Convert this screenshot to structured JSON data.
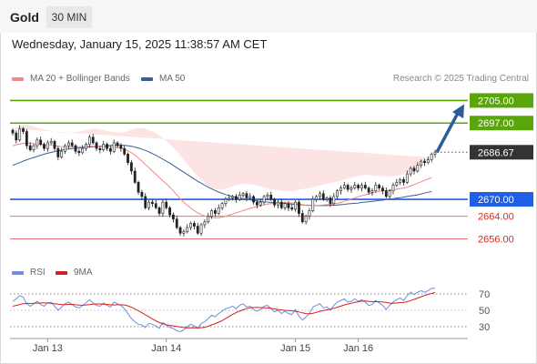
{
  "header": {
    "symbol": "Gold",
    "timeframe": "30 MIN"
  },
  "datetime": "Wednesday, January 15, 2025 11:38:57 AM CET",
  "legend": {
    "ma20": {
      "label": "MA 20 + Bollinger Bands",
      "color": "#f08a84"
    },
    "ma50": {
      "label": "MA 50",
      "color": "#3a5e94"
    },
    "rsi": {
      "label": "RSI",
      "color": "#6d8fd8"
    },
    "rsi9": {
      "label": "9MA",
      "color": "#d62020"
    }
  },
  "credit": "Research © 2025 Trading Central",
  "colors": {
    "green": "#5aa60a",
    "blue": "#1e5fe6",
    "red": "#e8736e",
    "current": "#333333",
    "bull": "#ffffff",
    "bear": "#222222",
    "band": "#fde4e4",
    "arrow": "#2e5c9a"
  },
  "chart_data": [
    {
      "type": "candlestick",
      "title": "Gold 30 MIN",
      "x_ticks": [
        "Jan 13",
        "Jan 14",
        "Jan 15",
        "Jan 16"
      ],
      "ylim": [
        2651,
        2709
      ],
      "current_price": "2686.67",
      "levels": [
        {
          "value": 2705.0,
          "label": "2705.00",
          "style": "green"
        },
        {
          "value": 2697.0,
          "label": "2697.00",
          "style": "green"
        },
        {
          "value": 2670.0,
          "label": "2670.00",
          "style": "blue"
        },
        {
          "value": 2664.0,
          "label": "2664.00",
          "style": "red"
        },
        {
          "value": 2656.0,
          "label": "2656.00",
          "style": "red"
        }
      ],
      "projection": {
        "from": 2686.67,
        "to": 2705.0
      },
      "close": [
        2693.5,
        2691,
        2695,
        2694,
        2689,
        2687.5,
        2689,
        2691,
        2689.5,
        2688,
        2690,
        2690.5,
        2688,
        2685,
        2687,
        2689,
        2690,
        2689,
        2687,
        2686.5,
        2688,
        2689.5,
        2692,
        2690,
        2688,
        2687.5,
        2689.5,
        2688,
        2687,
        2690,
        2689,
        2688,
        2686,
        2683,
        2680,
        2676,
        2672.5,
        2671,
        2667,
        2669,
        2668.5,
        2667,
        2665,
        2669,
        2667,
        2664.5,
        2663,
        2660,
        2658,
        2658.5,
        2660,
        2661.5,
        2660.5,
        2658,
        2661,
        2662,
        2664,
        2666,
        2665,
        2667,
        2668.5,
        2670,
        2670.5,
        2671,
        2670,
        2671.5,
        2672,
        2670.5,
        2671,
        2669,
        2668,
        2669,
        2671,
        2671.5,
        2670,
        2668,
        2669,
        2667,
        2668.5,
        2667,
        2666.5,
        2669,
        2665,
        2662,
        2664,
        2666,
        2670,
        2671,
        2672,
        2670,
        2670.5,
        2668.5,
        2671,
        2673,
        2674,
        2675,
        2673.5,
        2674,
        2675,
        2674,
        2675,
        2674,
        2672.5,
        2673,
        2675,
        2674,
        2673,
        2671,
        2673,
        2675,
        2676,
        2677,
        2676,
        2679,
        2681,
        2680,
        2682,
        2683.5,
        2683,
        2684,
        2686,
        2686.7
      ],
      "ma20": [
        2689,
        2689.3,
        2689.6,
        2689.8,
        2690,
        2689.9,
        2689.7,
        2689.5,
        2689.4,
        2689.3,
        2689.3,
        2689.2,
        2689,
        2688.8,
        2688.6,
        2688.5,
        2688.5,
        2688.6,
        2688.6,
        2688.6,
        2688.6,
        2688.7,
        2688.8,
        2688.8,
        2688.8,
        2688.7,
        2688.7,
        2688.7,
        2688.6,
        2688.5,
        2688.4,
        2688.2,
        2687.8,
        2687.2,
        2686.5,
        2685.7,
        2684.6,
        2683.5,
        2682.3,
        2681.2,
        2680,
        2678.9,
        2677.7,
        2676.6,
        2675.5,
        2674.3,
        2673,
        2671.6,
        2670.2,
        2669,
        2667.9,
        2666.9,
        2666,
        2665.2,
        2664.6,
        2664.1,
        2663.8,
        2663.6,
        2663.5,
        2663.5,
        2663.7,
        2664,
        2664.4,
        2664.8,
        2665.2,
        2665.6,
        2666,
        2666.4,
        2666.8,
        2667.1,
        2667.4,
        2667.7,
        2668,
        2668.3,
        2668.5,
        2668.6,
        2668.7,
        2668.8,
        2668.8,
        2668.8,
        2668.7,
        2668.6,
        2668.4,
        2668.1,
        2667.9,
        2667.8,
        2667.8,
        2667.8,
        2667.9,
        2668,
        2668.1,
        2668.2,
        2668.4,
        2668.6,
        2668.9,
        2669.3,
        2669.7,
        2670.1,
        2670.5,
        2670.9,
        2671.3,
        2671.6,
        2671.9,
        2672.2,
        2672.5,
        2672.8,
        2673,
        2673.1,
        2673.2,
        2673.4,
        2673.6,
        2673.8,
        2674,
        2674.3,
        2674.7,
        2675.2,
        2675.7,
        2676.2,
        2676.7,
        2677.2,
        2677.6
      ],
      "bb_upper": [
        2695,
        2695.5,
        2696,
        2696.3,
        2696.5,
        2696.2,
        2695.8,
        2695.4,
        2695,
        2694.7,
        2694.5,
        2694.3,
        2694,
        2693.8,
        2693.6,
        2693.5,
        2693.5,
        2693.6,
        2693.8,
        2694,
        2694.2,
        2694.5,
        2694.8,
        2695,
        2695,
        2694.8,
        2694.5,
        2694.2,
        2694,
        2693.8,
        2693.6,
        2693.6,
        2693.8,
        2694.2,
        2694.6,
        2695,
        2695.2,
        2695.2,
        2695,
        2694.6,
        2694.1,
        2693.4,
        2692.6,
        2691.7,
        2690.7,
        2689.6,
        2688.4,
        2687,
        2685.5,
        2684,
        2682.5,
        2681,
        2679.6,
        2678.3,
        2677,
        2675.8,
        2674.8,
        2674,
        2673.6,
        2673.4,
        2673.5,
        2673.8,
        2674.2,
        2674.6,
        2675,
        2675.3,
        2675.5,
        2675.5,
        2675.4,
        2675.2,
        2674.9,
        2674.5,
        2674.2,
        2673.9,
        2673.6,
        2673.4,
        2673.2,
        2673,
        2672.9,
        2672.8,
        2672.8,
        2673,
        2673.3,
        2673.6,
        2673.8,
        2674,
        2674.3,
        2674.6,
        2674.9,
        2675.2,
        2675.5,
        2675.8,
        2676,
        2676.3,
        2676.6,
        2677,
        2677.4,
        2677.7,
        2678,
        2678.3,
        2678.5,
        2678.6,
        2678.6,
        2678.5,
        2678.4,
        2678.3,
        2678.2,
        2678.1,
        2678,
        2678.1,
        2678.3,
        2678.6,
        2679,
        2679.5,
        2680.1,
        2680.8,
        2681.6,
        2682.4,
        2683.2,
        2684,
        2684.8
      ],
      "bb_lower": [
        2683,
        2683.1,
        2683.2,
        2683.3,
        2683.5,
        2683.6,
        2683.6,
        2683.6,
        2683.8,
        2683.9,
        2684.1,
        2684.1,
        2684,
        2683.8,
        2683.6,
        2683.5,
        2683.5,
        2683.6,
        2683.4,
        2683.2,
        2683,
        2682.9,
        2682.8,
        2682.6,
        2682.6,
        2682.6,
        2682.9,
        2683.2,
        2683.2,
        2683.2,
        2683.2,
        2682.8,
        2681.8,
        2680.2,
        2678.4,
        2676.4,
        2674,
        2671.8,
        2669.6,
        2667.8,
        2665.9,
        2664.4,
        2662.8,
        2661.5,
        2660.3,
        2659,
        2657.6,
        2656.2,
        2654.9,
        2654,
        2653.3,
        2652.8,
        2652.4,
        2652.1,
        2652.2,
        2652.4,
        2652.8,
        2653.2,
        2653.4,
        2653.6,
        2653.9,
        2654.2,
        2654.6,
        2655,
        2655.4,
        2655.9,
        2656.5,
        2657.3,
        2658.2,
        2659,
        2659.9,
        2660.9,
        2661.8,
        2662.7,
        2663.4,
        2663.8,
        2664.2,
        2664.6,
        2664.7,
        2664.8,
        2664.6,
        2664.2,
        2663.5,
        2662.6,
        2662,
        2661.6,
        2661.3,
        2661,
        2660.9,
        2660.8,
        2660.7,
        2660.6,
        2660.8,
        2660.9,
        2661.2,
        2661.6,
        2662,
        2662.5,
        2663,
        2663.5,
        2664.1,
        2664.6,
        2665.2,
        2665.9,
        2666.6,
        2667.3,
        2667.8,
        2668.1,
        2668.4,
        2668.7,
        2668.9,
        2669,
        2669,
        2669.1,
        2669.3,
        2669.6,
        2669.8,
        2670,
        2670.2,
        2670.4,
        2670.4
      ],
      "ma50": [
        2682,
        2682.5,
        2683,
        2683.5,
        2684,
        2684.4,
        2684.8,
        2685.2,
        2685.6,
        2686,
        2686.3,
        2686.6,
        2686.9,
        2687.2,
        2687.4,
        2687.6,
        2687.8,
        2688,
        2688.1,
        2688.2,
        2688.3,
        2688.4,
        2688.5,
        2688.6,
        2688.7,
        2688.8,
        2688.9,
        2689,
        2689.1,
        2689.2,
        2689.2,
        2689.2,
        2689.1,
        2689,
        2688.8,
        2688.5,
        2688.2,
        2687.8,
        2687.3,
        2686.8,
        2686.2,
        2685.6,
        2684.9,
        2684.2,
        2683.5,
        2682.8,
        2682,
        2681.2,
        2680.4,
        2679.6,
        2678.8,
        2678,
        2677.2,
        2676.4,
        2675.7,
        2675,
        2674.3,
        2673.7,
        2673.1,
        2672.6,
        2672.1,
        2671.7,
        2671.3,
        2671,
        2670.7,
        2670.4,
        2670.2,
        2670,
        2669.8,
        2669.6,
        2669.4,
        2669.2,
        2669.1,
        2669,
        2668.9,
        2668.8,
        2668.7,
        2668.6,
        2668.5,
        2668.4,
        2668.3,
        2668.2,
        2668.1,
        2668,
        2667.9,
        2667.9,
        2667.8,
        2667.8,
        2667.8,
        2667.8,
        2667.8,
        2667.9,
        2667.9,
        2668,
        2668.1,
        2668.2,
        2668.4,
        2668.5,
        2668.6,
        2668.7,
        2668.9,
        2669,
        2669.1,
        2669.3,
        2669.4,
        2669.6,
        2669.7,
        2669.9,
        2670,
        2670.2,
        2670.4,
        2670.6,
        2670.8,
        2671,
        2671.2,
        2671.4,
        2671.6,
        2671.9,
        2672.2,
        2672.5,
        2672.8
      ],
      "x_tick_index": [
        10,
        44,
        81,
        99
      ],
      "price_axis": "right"
    },
    {
      "type": "line",
      "title": "RSI",
      "ylim": [
        20,
        80
      ],
      "y_ticks": [
        "70",
        "50",
        "30"
      ],
      "series": [
        {
          "name": "RSI",
          "values": [
            61,
            64,
            68,
            66,
            58,
            55,
            58,
            61,
            57,
            55,
            59,
            60,
            55,
            50,
            54,
            58,
            60,
            57,
            54,
            53,
            56,
            59,
            63,
            59,
            56,
            55,
            59,
            56,
            54,
            60,
            58,
            56,
            52,
            46,
            40,
            36,
            33,
            32,
            29,
            34,
            33,
            31,
            28,
            35,
            32,
            29,
            28,
            25,
            24,
            26,
            30,
            33,
            31,
            28,
            34,
            36,
            40,
            44,
            42,
            46,
            49,
            52,
            53,
            55,
            52,
            56,
            58,
            54,
            55,
            51,
            49,
            51,
            55,
            56,
            52,
            48,
            50,
            46,
            49,
            46,
            45,
            51,
            43,
            38,
            42,
            46,
            54,
            56,
            58,
            53,
            54,
            50,
            56,
            60,
            62,
            64,
            60,
            61,
            64,
            61,
            63,
            60,
            56,
            57,
            62,
            59,
            56,
            51,
            56,
            60,
            63,
            65,
            62,
            68,
            72,
            69,
            72,
            74,
            72,
            74,
            77,
            77
          ]
        },
        {
          "name": "9MA",
          "values": [
            55,
            56,
            57,
            58,
            58.5,
            58.5,
            58.6,
            58.8,
            59,
            59,
            59,
            58.5,
            58,
            57.5,
            57,
            57,
            57.2,
            57.2,
            56.8,
            56.4,
            56.2,
            56.5,
            57,
            57.5,
            57.8,
            57.8,
            57.6,
            57.2,
            56.8,
            56.6,
            56.8,
            56.8,
            56.5,
            55.5,
            53.8,
            51.8,
            49.5,
            47,
            44.5,
            42,
            39.5,
            37.2,
            35,
            33.4,
            32.3,
            31.5,
            31,
            30.3,
            29.6,
            29,
            28.7,
            28.6,
            28.8,
            28.6,
            28.8,
            29.3,
            30.5,
            32.2,
            33.8,
            35.6,
            37.5,
            39.9,
            42.5,
            45,
            47.2,
            49,
            50.6,
            52,
            53.1,
            53.5,
            53.6,
            53.3,
            53,
            52.9,
            52.5,
            51.7,
            51,
            50.5,
            50,
            49.7,
            49.3,
            49,
            48,
            46.9,
            46,
            45.7,
            46.4,
            47.4,
            48.8,
            49.7,
            50.6,
            51.3,
            52.5,
            53.8,
            55.1,
            56.5,
            57.7,
            58.6,
            59.8,
            60.4,
            61.2,
            61.3,
            61,
            60.6,
            60.7,
            60.5,
            60.2,
            59.5,
            58.8,
            58.6,
            58.9,
            59.4,
            59.6,
            60.5,
            61.9,
            63.3,
            64.9,
            66.5,
            68,
            69.4,
            70.6,
            71.8
          ]
        }
      ]
    }
  ]
}
